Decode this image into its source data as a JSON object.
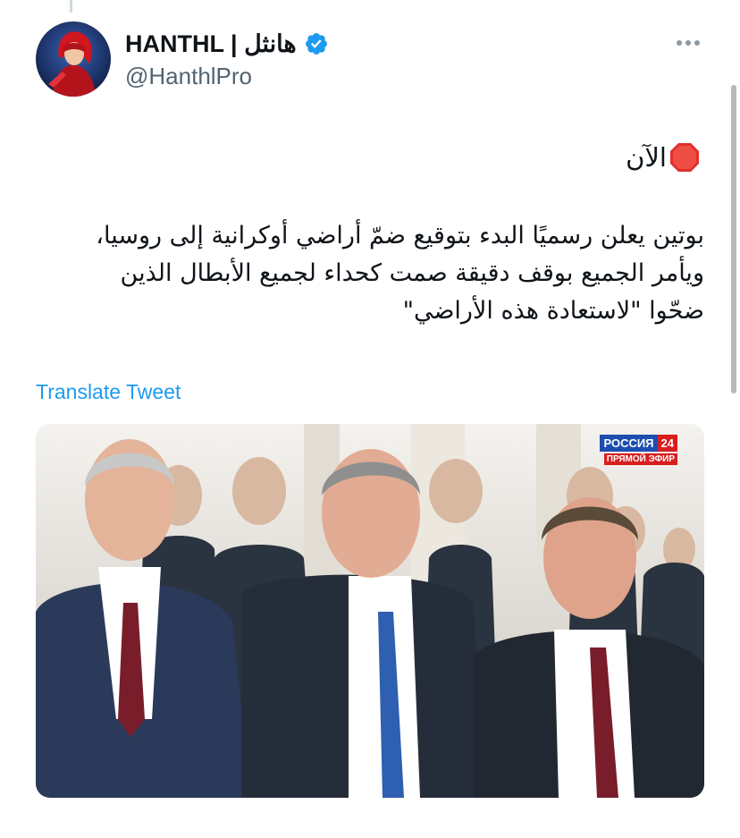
{
  "tweet": {
    "author": {
      "display_name": "HANTHL | هانثل",
      "handle": "@HanthlPro",
      "avatar": "avatar-icon",
      "verified_icon": "verified-badge-icon"
    },
    "more_icon": "more-options-icon",
    "lines": {
      "now": "الآن",
      "now_icon": "stop-sign-icon",
      "body": [
        "بوتين يعلن رسميًا البدء بتوقيع ضمّ أراضي أوكرانية إلى روسيا،",
        "ويأمر الجميع بوقف دقيقة صمت كحداء لجميع الأبطال الذين",
        "ضحّوا \"لاستعادة هذه الأراضي\""
      ]
    },
    "translate_label": "Translate Tweet",
    "media": {
      "logo_name": "РОССИЯ",
      "logo_number": "24",
      "logo_live": "ПРЯМОЙ ЭФИР"
    }
  },
  "colors": {
    "link": "#1d9bf0",
    "verified": "#1d9bf0",
    "secondary_text": "#536471"
  }
}
